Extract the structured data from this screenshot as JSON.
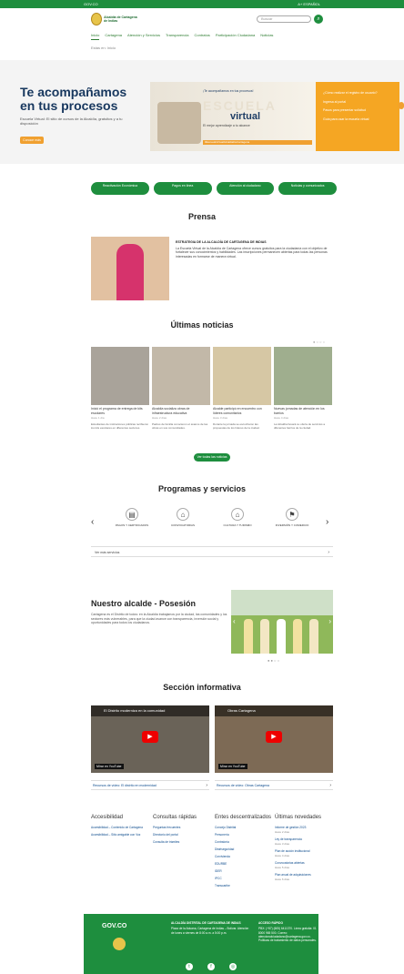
{
  "topbar": {
    "left": "GOV.CO",
    "right": "A+ ESPAÑOL"
  },
  "header": {
    "logo_text": "Alcaldía de Cartagena de Indias",
    "search_placeholder": "Buscar"
  },
  "nav": [
    "Inicio",
    "Cartagena",
    "Atención y Servicios",
    "Transparencia",
    "Contratos",
    "Participación Ciudadana",
    "Noticias"
  ],
  "breadcrumb": "Estás en: Inicio",
  "hero": {
    "title": "Te acompañamos en tus procesos",
    "text": "Escuela Virtual: El sitio de cursos de la Alcaldía, gratuitos y a tu disposición",
    "button": "Conoce más"
  },
  "banner": {
    "small_top": "¡Te acompañamos en tus procesos!",
    "escuela": "ESCUELA",
    "virtual": "virtual",
    "small_text": "El mejor aprendizaje a tu alcance",
    "tag": "#EscuelaVirtualAlcaldiaDeCartagena",
    "list": [
      "¿Cómo realizar el registro de usuario?",
      "Ingresa al portal",
      "Pasos para presentar solicitud",
      "Guía para usar la escuela virtual"
    ]
  },
  "quick": [
    "Reactivación Económica",
    "Pagos en línea",
    "Atención al ciudadano",
    "Noticias y comunicados"
  ],
  "sections": {
    "prensa": "Prensa",
    "noticias": "Últimas noticias",
    "programas": "Programas y servicios",
    "informativa": "Sección informativa"
  },
  "prensa": {
    "headline": "ESTRATEGIA DE LA ALCALDÍA DE CARTAGENA DE INDIAS",
    "text": "La Escuela Virtual de la Alcaldía de Cartagena ofrece cursos gratuitos para la ciudadanía con el objetivo de fortalecer sus conocimientos y habilidades. Las inscripciones permanecen abiertas para todas las personas interesadas en formarse de manera virtual."
  },
  "news": [
    {
      "title": "Inició el programa de entrega de kits escolares",
      "date": "Hace 1 día",
      "body": "Estudiantes de instituciones públicas recibieron los kits escolares en diferentes sectores."
    },
    {
      "title": "Alcaldía socializa obras de infraestructura educativa",
      "date": "Hace 2 días",
      "body": "Padres de familia conocieron el avance de las obras en sus comunidades."
    },
    {
      "title": "Alcalde participó en encuentro con líderes comunitarios",
      "date": "Hace 3 días",
      "body": "Durante la jornada se escucharon las propuestas de los líderes de la ciudad."
    },
    {
      "title": "Nuevas jornadas de atención en los barrios",
      "date": "Hace 4 días",
      "body": "La Alcaldía llevará su oferta de servicios a diferentes barrios de la ciudad."
    }
  ],
  "news_button": "Ver todas las noticias",
  "programs": [
    {
      "label": "PAGOS Y CERTIFICADOS",
      "icon": "document-icon",
      "glyph": "▤"
    },
    {
      "label": "CONVOCATORIAS",
      "icon": "building-icon",
      "glyph": "⌂"
    },
    {
      "label": "CULTURA Y TURISMO",
      "icon": "house-icon",
      "glyph": "⌂"
    },
    {
      "label": "INVERSIÓN Y COMERCIO",
      "icon": "truck-icon",
      "glyph": "⚑"
    }
  ],
  "verpasos": "Ver más servicios",
  "alcalde": {
    "title": "Nuestro alcalde - Posesión",
    "text": "Cartagena es el Distrito de todos: en la Alcaldía trabajamos por la ciudad, las comunidades y los sectores más vulnerables, para que la ciudad avance con transparencia, inversión social y oportunidades para todos los ciudadanos."
  },
  "videos": [
    {
      "title": "El Distrito moderniza en la comunidad",
      "label": "Recursos de vídeo: El distrito en modernidad"
    },
    {
      "title": "Obras Cartagena",
      "label": "Recursos de vídeo: Obras Cartagena"
    }
  ],
  "video_badge": "Mirar en YouTube",
  "cols": [
    {
      "title": "Accesibilidad",
      "items": [
        "Accesibilidad – Contenido de Cartagena",
        "Accesibilidad – Sitio amigable con Voz"
      ]
    },
    {
      "title": "Consultas rápidas",
      "items": [
        "Preguntas frecuentes",
        "Directorio del portal",
        "Consulta de trámites"
      ]
    },
    {
      "title": "Entes descentralizados",
      "items": [
        "Concejo Distrital",
        "Personería",
        "Contraloría",
        "Distriseguridad",
        "Corvivienda",
        "EDURBE",
        "IDER",
        "IPCC",
        "Transcaribe"
      ]
    },
    {
      "title": "Últimas novedades",
      "items": [
        "Informe de gestión 2023",
        "Ley de transparencia",
        "Plan de acción institucional",
        "Convocatorias abiertas",
        "Plan anual de adquisiciones"
      ],
      "dates": [
        "Hace 2 días",
        "Hace 3 días",
        "Hace 4 días",
        "Hace 5 días",
        "Hace 6 días"
      ]
    }
  ],
  "footer": {
    "govco": "GOV.CO",
    "mid_title": "ALCALDÍA DISTRITAL DE CARTAGENA DE INDIAS",
    "mid_text": "Plaza de la Aduana, Cartagena de Indias – Bolívar. Atención de lunes a viernes de 8:00 a.m. a 5:00 p.m.",
    "rt_title": "ACCESO RÁPIDO",
    "rt_text": "PBX: (+57) (605) 6411370. Línea gratuita: 01 8000 965 500. Correo: atencionalciudadano@cartagena.gov.co. Políticas de tratamiento de datos personales."
  }
}
